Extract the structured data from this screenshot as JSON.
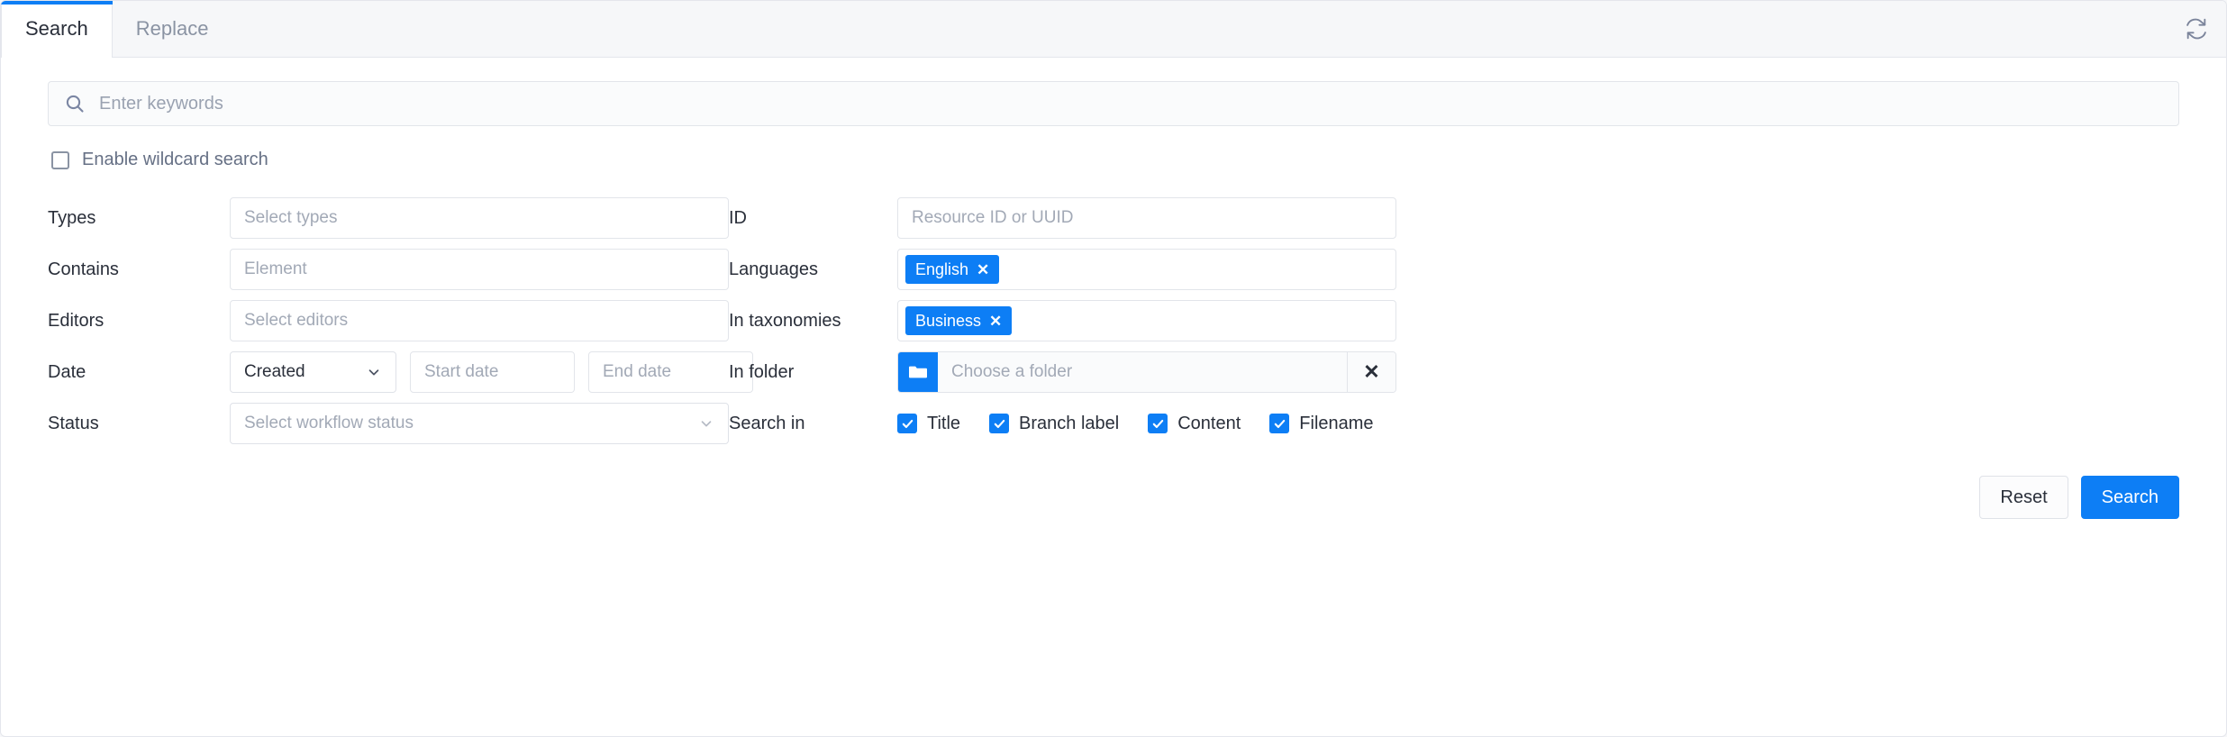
{
  "tabs": [
    {
      "label": "Search",
      "active": true
    },
    {
      "label": "Replace",
      "active": false
    }
  ],
  "toolbar": {
    "refresh_icon": "refresh-icon"
  },
  "search": {
    "placeholder": "Enter keywords",
    "value": "",
    "icon": "search-icon"
  },
  "wildcard": {
    "label": "Enable wildcard search",
    "checked": false
  },
  "fields": {
    "types": {
      "label": "Types",
      "placeholder": "Select types",
      "value": ""
    },
    "contains": {
      "label": "Contains",
      "placeholder": "Element",
      "value": ""
    },
    "editors": {
      "label": "Editors",
      "placeholder": "Select editors",
      "value": ""
    },
    "date": {
      "label": "Date",
      "type_value": "Created",
      "start_placeholder": "Start date",
      "start_value": "",
      "end_placeholder": "End date",
      "end_value": ""
    },
    "status": {
      "label": "Status",
      "placeholder": "Select workflow status",
      "value": ""
    },
    "id": {
      "label": "ID",
      "placeholder": "Resource ID or UUID",
      "value": ""
    },
    "languages": {
      "label": "Languages",
      "tags": [
        "English"
      ]
    },
    "taxonomies": {
      "label": "In taxonomies",
      "tags": [
        "Business"
      ]
    },
    "folder": {
      "label": "In folder",
      "placeholder": "Choose a folder",
      "value": "",
      "browse_icon": "folder-icon",
      "clear_icon": "close-icon"
    },
    "search_in": {
      "label": "Search in",
      "options": [
        {
          "label": "Title",
          "checked": true
        },
        {
          "label": "Branch label",
          "checked": true
        },
        {
          "label": "Content",
          "checked": true
        },
        {
          "label": "Filename",
          "checked": true
        }
      ]
    }
  },
  "actions": {
    "reset_label": "Reset",
    "search_label": "Search"
  },
  "colors": {
    "accent": "#0d7ef5",
    "tab_active_bar": "#0d7ef5",
    "label_text": "#2a2f3a",
    "placeholder_text": "#a2a9b6",
    "muted_text": "#667085",
    "border": "#e2e5ea",
    "panel_bg": "#ffffff",
    "tabbar_bg": "#f6f7f9"
  }
}
